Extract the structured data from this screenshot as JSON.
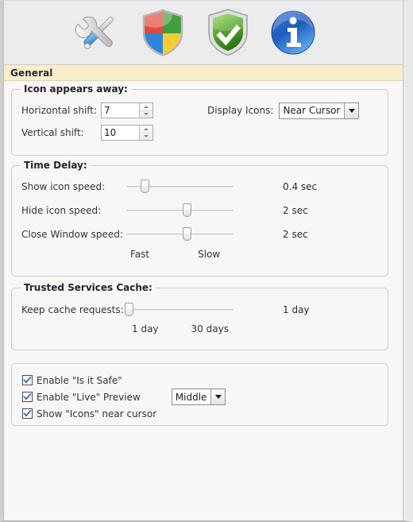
{
  "window": {
    "section_title": "General"
  },
  "toolbar": {
    "buttons": [
      {
        "name": "tools-icon",
        "label": "Tools"
      },
      {
        "name": "security-shield-icon",
        "label": "Security"
      },
      {
        "name": "green-check-shield-icon",
        "label": "Safe"
      },
      {
        "name": "info-icon",
        "label": "Information"
      }
    ]
  },
  "icon_appears_away": {
    "title": "Icon appears away:",
    "horizontal_shift_label": "Horizontal shift:",
    "horizontal_shift_value": "7",
    "vertical_shift_label": "Vertical shift:",
    "vertical_shift_value": "10",
    "display_icons_label": "Display Icons:",
    "display_icons_value": "Near Cursor",
    "display_icons_options": [
      "Near Cursor"
    ]
  },
  "time_delay": {
    "title": "Time Delay:",
    "rows": [
      {
        "label": "Show icon speed:",
        "value": "0.4 sec",
        "percent": 17
      },
      {
        "label": "Hide icon speed:",
        "value": "2 sec",
        "percent": 56
      },
      {
        "label": "Close Window speed:",
        "value": "2 sec",
        "percent": 56
      }
    ],
    "scale_min": "Fast",
    "scale_max": "Slow"
  },
  "trusted_services_cache": {
    "title": "Trusted Services Cache:",
    "row": {
      "label": "Keep cache requests:",
      "value": "1 day",
      "percent": 2
    },
    "scale_min": "1 day",
    "scale_max": "30 days"
  },
  "options": {
    "items": [
      {
        "label": "Enable \"Is it Safe\"",
        "checked": true
      },
      {
        "label": "Enable \"Live\" Preview",
        "checked": true
      },
      {
        "label": "Show \"Icons\" near cursor",
        "checked": true
      }
    ],
    "preview_select_value": "Middle",
    "preview_select_options": [
      "Middle"
    ]
  },
  "colors": {
    "header_bar": "#faeeca",
    "toolbar": "#ececec",
    "panel": "#f7f7f7",
    "checkmark": "#3a64b0"
  }
}
